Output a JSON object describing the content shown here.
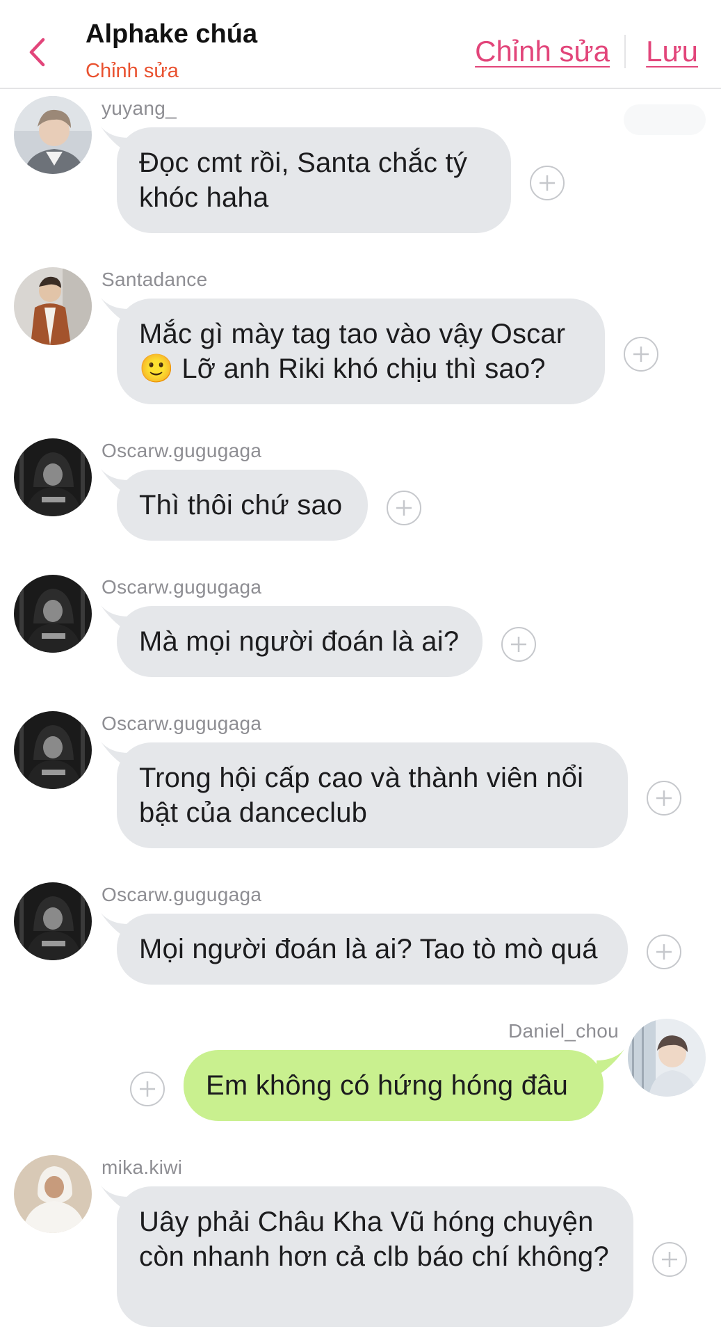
{
  "header": {
    "title": "Alphake chúa",
    "subtitle": "Chỉnh sửa",
    "edit_label": "Chỉnh sửa",
    "save_label": "Lưu",
    "back_icon": "chevron-left-icon",
    "accent_color": "#e2457a",
    "subtitle_color": "#e9512f"
  },
  "colors": {
    "incoming_bubble": "#e5e7ea",
    "outgoing_bubble": "#c9f08f",
    "sender_text": "#8e8e93"
  },
  "messages": [
    {
      "sender": "yuyang_",
      "text": "Đọc cmt rồi, Santa chắc tý khóc haha",
      "direction": "incoming",
      "action_icon": "plus-circle-icon"
    },
    {
      "sender": "Santadance",
      "text": "Mắc gì mày tag tao vào vậy Oscar 🙂 Lỡ anh Riki khó chịu thì sao?",
      "direction": "incoming",
      "action_icon": "plus-circle-icon"
    },
    {
      "sender": "Oscarw.gugugaga",
      "text": "Thì thôi chứ sao",
      "direction": "incoming",
      "action_icon": "plus-circle-icon"
    },
    {
      "sender": "Oscarw.gugugaga",
      "text": "Mà mọi người đoán là ai?",
      "direction": "incoming",
      "action_icon": "plus-circle-icon"
    },
    {
      "sender": "Oscarw.gugugaga",
      "text": "Trong hội cấp cao và thành viên nổi bật của danceclub",
      "direction": "incoming",
      "action_icon": "plus-circle-icon"
    },
    {
      "sender": "Oscarw.gugugaga",
      "text": "Mọi người đoán là ai? Tao tò mò quá",
      "direction": "incoming",
      "action_icon": "plus-circle-icon"
    },
    {
      "sender": "Daniel_chou",
      "text": "Em không có hứng hóng đâu",
      "direction": "outgoing",
      "action_icon": "plus-circle-icon"
    },
    {
      "sender": "mika.kiwi",
      "text": "Uây phải Châu Kha Vũ hóng chuyện còn nhanh hơn cả clb báo chí không?",
      "direction": "incoming",
      "action_icon": "plus-circle-icon"
    }
  ]
}
